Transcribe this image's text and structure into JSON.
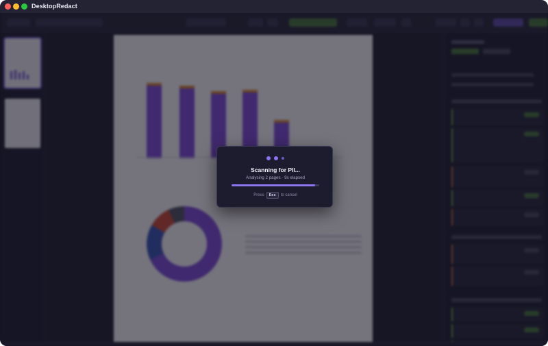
{
  "window": {
    "title": "DesktopRedact",
    "controls": {
      "close": {
        "icon": "close-dot-icon",
        "color": "#fe5f57"
      },
      "minimize": {
        "icon": "minimize-dot-icon",
        "color": "#febc2e"
      },
      "zoom": {
        "icon": "zoom-dot-icon",
        "color": "#28c840"
      }
    }
  },
  "modal": {
    "title": "Scanning for PII...",
    "subtitle": "Analysing 2 pages · 9s elapsed",
    "progress": 0.95,
    "hint_prefix": "Press",
    "hint_key": "Esc",
    "hint_suffix": "to cancel",
    "accent": "#8d75f2"
  },
  "colors": {
    "background": "#1b1a2b",
    "panel": "#232335",
    "accent_violet": "#7e4fd8",
    "status_green": "#4b7a3f",
    "status_orange": "#c9743a"
  }
}
